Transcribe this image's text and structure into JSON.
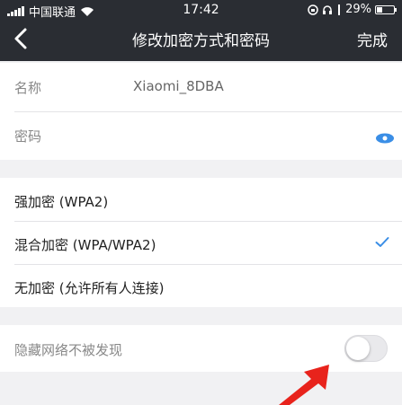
{
  "status_bar": {
    "carrier": "中国联通",
    "time": "17:42",
    "battery": "29%"
  },
  "nav": {
    "title": "修改加密方式和密码",
    "done_label": "完成"
  },
  "fields": {
    "name_label": "名称",
    "name_value": "Xiaomi_8DBA",
    "password_label": "密码"
  },
  "encryption": {
    "options": [
      "强加密 (WPA2)",
      "混合加密 (WPA/WPA2)",
      "无加密 (允许所有人连接)"
    ],
    "selected": "混合加密 (WPA/WPA2)"
  },
  "hidden_network": {
    "label": "隐藏网络不被发现",
    "enabled": false
  },
  "colors": {
    "accent": "#3a8ee6",
    "header": "#2a2d33",
    "annotation": "#e8231c"
  }
}
